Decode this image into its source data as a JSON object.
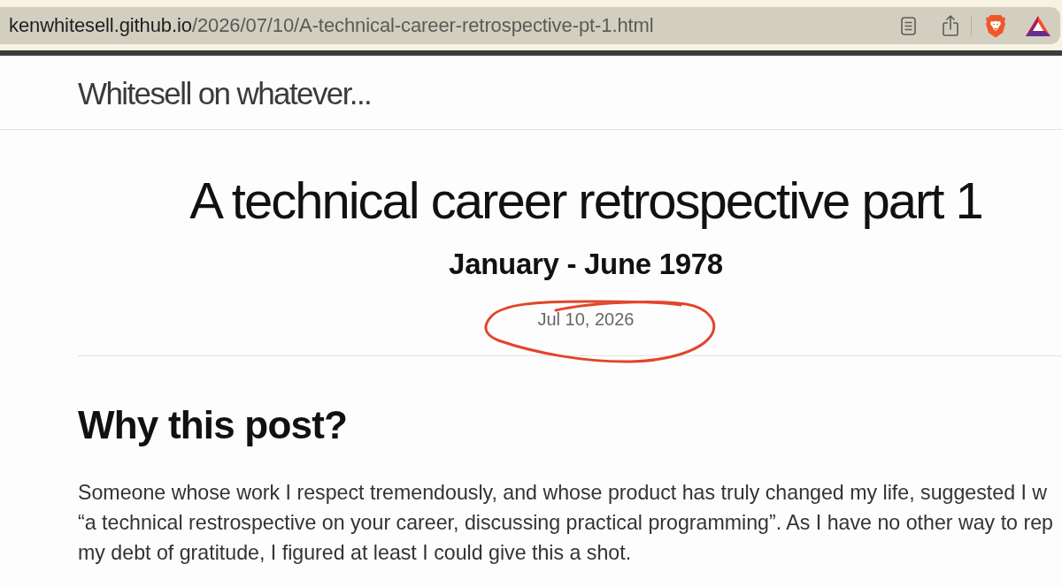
{
  "browser": {
    "url_domain": "kenwhitesell.github.io",
    "url_path": "/2026/07/10/A-technical-career-retrospective-pt-1.html"
  },
  "site": {
    "title": "Whitesell on whatever..."
  },
  "post": {
    "title": "A technical career retrospective part 1",
    "subtitle": "January - June 1978",
    "date": {
      "text": "Jul 10, 2026",
      "circled": true
    },
    "sections": [
      {
        "heading": "Why this post?",
        "lines": [
          "Someone whose work I respect tremendously, and whose product has truly changed my life, suggested I w",
          "“a technical restrospective on your career, discussing practical programming”. As I have no other way to rep",
          "my debt of gratitude, I figured at least I could give this a shot."
        ]
      }
    ]
  }
}
